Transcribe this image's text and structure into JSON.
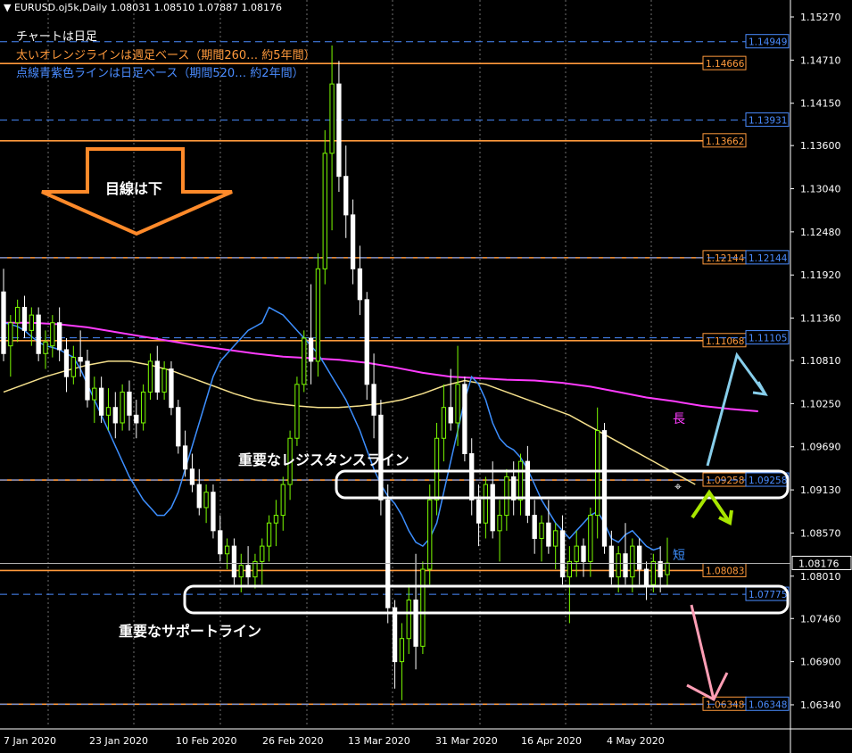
{
  "header": {
    "symbol": "EURUSD.oj5k,Daily",
    "ohlc": "1.08031 1.08510 1.07887 1.08176"
  },
  "notes": [
    {
      "text": "チャートは日足",
      "color": "#ffffff"
    },
    {
      "text": "太いオレンジラインは週足ベース（期間260… 約5年間）",
      "color": "#ff9a3c"
    },
    {
      "text": "点線青紫色ラインは日足ベース（期間520… 約2年間）",
      "color": "#4a8cff"
    }
  ],
  "annotations": {
    "arrow_text": "目線は下",
    "resistance": "重要なレジスタンスライン",
    "support": "重要なサポートライン",
    "long_ma": "長",
    "short_ma": "短"
  },
  "colors": {
    "background": "#000000",
    "grid": "#6f6f6f",
    "bull_candle": "#7CFC00",
    "bear_candle": "#ffffff",
    "orange_level": "#ff9a3c",
    "blue_level": "#4a8cff",
    "short_ma": "#3d8fff",
    "mid_ma": "#f5e08c",
    "long_ma": "#ff3cff",
    "current_price": "#b0b0b0"
  },
  "chart_data": {
    "type": "candlestick",
    "title": "EURUSD.oj5k,Daily",
    "timeframe": "Daily",
    "grid": true,
    "ylim": [
      1.0605,
      1.1549
    ],
    "y_ticks": [
      "1.15270",
      "1.14710",
      "1.14150",
      "1.13600",
      "1.13040",
      "1.12480",
      "1.11920",
      "1.11360",
      "1.10810",
      "1.10250",
      "1.09690",
      "1.09130",
      "1.08570",
      "1.08010",
      "1.07460",
      "1.06900",
      "1.06340"
    ],
    "x_ticks": [
      "7 Jan 2020",
      "23 Jan 2020",
      "10 Feb 2020",
      "26 Feb 2020",
      "13 Mar 2020",
      "31 Mar 2020",
      "16 Apr 2020",
      "4 May 2020"
    ],
    "current_price": "1.08176",
    "orange_levels": [
      "1.14666",
      "1.13662",
      "1.12144",
      "1.11068",
      "1.09258",
      "1.08083",
      "1.06348"
    ],
    "blue_levels": [
      "1.14949",
      "1.13931",
      "1.12144",
      "1.11105",
      "1.09258",
      "1.07775",
      "1.06348"
    ],
    "candles": [
      [
        1.117,
        1.12,
        1.108,
        1.109
      ],
      [
        1.11,
        1.114,
        1.106,
        1.113
      ],
      [
        1.113,
        1.116,
        1.1105,
        1.115
      ],
      [
        1.115,
        1.1165,
        1.111,
        1.112
      ],
      [
        1.112,
        1.115,
        1.11,
        1.114
      ],
      [
        1.114,
        1.115,
        1.108,
        1.109
      ],
      [
        1.109,
        1.112,
        1.107,
        1.1105
      ],
      [
        1.11,
        1.114,
        1.1085,
        1.113
      ],
      [
        1.113,
        1.115,
        1.108,
        1.1095
      ],
      [
        1.1095,
        1.111,
        1.104,
        1.106
      ],
      [
        1.106,
        1.11,
        1.105,
        1.1085
      ],
      [
        1.1085,
        1.112,
        1.106,
        1.108
      ],
      [
        1.108,
        1.1095,
        1.102,
        1.103
      ],
      [
        1.103,
        1.106,
        1.1,
        1.1045
      ],
      [
        1.1045,
        1.106,
        1.1,
        1.101
      ],
      [
        1.101,
        1.1045,
        1.099,
        1.102
      ],
      [
        1.102,
        1.104,
        1.098,
        1.1
      ],
      [
        1.1,
        1.105,
        1.099,
        1.104
      ],
      [
        1.104,
        1.1055,
        1.099,
        1.101
      ],
      [
        1.101,
        1.103,
        1.098,
        1.1
      ],
      [
        1.1,
        1.105,
        1.099,
        1.104
      ],
      [
        1.104,
        1.109,
        1.103,
        1.108
      ],
      [
        1.108,
        1.11,
        1.103,
        1.104
      ],
      [
        1.104,
        1.108,
        1.103,
        1.107
      ],
      [
        1.107,
        1.108,
        1.101,
        1.102
      ],
      [
        1.102,
        1.103,
        1.096,
        1.097
      ],
      [
        1.097,
        1.099,
        1.093,
        1.094
      ],
      [
        1.094,
        1.096,
        1.091,
        1.092
      ],
      [
        1.092,
        1.094,
        1.088,
        1.089
      ],
      [
        1.089,
        1.092,
        1.087,
        1.091
      ],
      [
        1.091,
        1.092,
        1.085,
        1.086
      ],
      [
        1.086,
        1.088,
        1.082,
        1.083
      ],
      [
        1.083,
        1.085,
        1.081,
        1.084
      ],
      [
        1.084,
        1.085,
        1.079,
        1.08
      ],
      [
        1.08,
        1.083,
        1.078,
        1.0815
      ],
      [
        1.0815,
        1.084,
        1.079,
        1.08
      ],
      [
        1.08,
        1.083,
        1.0785,
        1.082
      ],
      [
        1.082,
        1.085,
        1.079,
        1.084
      ],
      [
        1.084,
        1.088,
        1.082,
        1.087
      ],
      [
        1.087,
        1.09,
        1.084,
        1.088
      ],
      [
        1.088,
        1.093,
        1.086,
        1.092
      ],
      [
        1.092,
        1.099,
        1.09,
        1.098
      ],
      [
        1.098,
        1.106,
        1.097,
        1.105
      ],
      [
        1.105,
        1.112,
        1.104,
        1.111
      ],
      [
        1.111,
        1.118,
        1.105,
        1.108
      ],
      [
        1.108,
        1.122,
        1.106,
        1.12
      ],
      [
        1.12,
        1.138,
        1.118,
        1.135
      ],
      [
        1.135,
        1.149,
        1.125,
        1.144
      ],
      [
        1.144,
        1.147,
        1.13,
        1.132
      ],
      [
        1.132,
        1.136,
        1.124,
        1.127
      ],
      [
        1.127,
        1.129,
        1.118,
        1.12
      ],
      [
        1.12,
        1.123,
        1.114,
        1.116
      ],
      [
        1.116,
        1.117,
        1.103,
        1.105
      ],
      [
        1.105,
        1.109,
        1.098,
        1.101
      ],
      [
        1.101,
        1.103,
        1.088,
        1.09
      ],
      [
        1.09,
        1.092,
        1.074,
        1.076
      ],
      [
        1.076,
        1.077,
        1.0655,
        1.069
      ],
      [
        1.069,
        1.074,
        1.064,
        1.072
      ],
      [
        1.072,
        1.079,
        1.07,
        1.077
      ],
      [
        1.077,
        1.083,
        1.068,
        1.071
      ],
      [
        1.071,
        1.082,
        1.07,
        1.081
      ],
      [
        1.081,
        1.092,
        1.079,
        1.09
      ],
      [
        1.09,
        1.1,
        1.088,
        1.098
      ],
      [
        1.098,
        1.105,
        1.095,
        1.102
      ],
      [
        1.102,
        1.107,
        1.099,
        1.1
      ],
      [
        1.1,
        1.11,
        1.097,
        1.105
      ],
      [
        1.105,
        1.106,
        1.095,
        1.096
      ],
      [
        1.096,
        1.098,
        1.088,
        1.09
      ],
      [
        1.09,
        1.092,
        1.084,
        1.087
      ],
      [
        1.087,
        1.093,
        1.085,
        1.092
      ],
      [
        1.092,
        1.095,
        1.085,
        1.086
      ],
      [
        1.086,
        1.09,
        1.082,
        1.088
      ],
      [
        1.088,
        1.094,
        1.086,
        1.093
      ],
      [
        1.093,
        1.095,
        1.088,
        1.09
      ],
      [
        1.09,
        1.096,
        1.088,
        1.095
      ],
      [
        1.095,
        1.097,
        1.087,
        1.088
      ],
      [
        1.088,
        1.09,
        1.083,
        1.085
      ],
      [
        1.085,
        1.088,
        1.082,
        1.087
      ],
      [
        1.087,
        1.09,
        1.083,
        1.084
      ],
      [
        1.084,
        1.087,
        1.081,
        1.086
      ],
      [
        1.086,
        1.088,
        1.079,
        1.08
      ],
      [
        1.08,
        1.084,
        1.074,
        1.082
      ],
      [
        1.082,
        1.086,
        1.08,
        1.084
      ],
      [
        1.084,
        1.085,
        1.08,
        1.082
      ],
      [
        1.082,
        1.089,
        1.08,
        1.088
      ],
      [
        1.088,
        1.102,
        1.085,
        1.099
      ],
      [
        1.099,
        1.1,
        1.083,
        1.084
      ],
      [
        1.084,
        1.086,
        1.079,
        1.08
      ],
      [
        1.08,
        1.084,
        1.078,
        1.083
      ],
      [
        1.083,
        1.087,
        1.079,
        1.08
      ],
      [
        1.08,
        1.085,
        1.078,
        1.084
      ],
      [
        1.084,
        1.085,
        1.079,
        1.081
      ],
      [
        1.081,
        1.082,
        1.077,
        1.079
      ],
      [
        1.079,
        1.083,
        1.078,
        1.082
      ],
      [
        1.082,
        1.084,
        1.078,
        1.08
      ],
      [
        1.0803,
        1.0851,
        1.0789,
        1.0818
      ]
    ],
    "ma_short": [
      1.115,
      1.1145,
      1.114,
      1.113,
      1.112,
      1.111,
      1.11,
      1.109,
      1.1075,
      1.106,
      1.1045,
      1.103,
      1.101,
      1.099,
      1.0965,
      1.094,
      1.092,
      1.0905,
      1.0895,
      1.088,
      1.086,
      1.0845,
      1.084,
      1.085,
      1.087,
      1.091,
      1.095,
      1.099,
      1.103,
      1.106,
      1.105,
      1.103,
      1.1,
      1.098,
      1.097,
      1.0965,
      1.0955,
      1.094,
      1.092,
      1.09,
      1.0885,
      1.087,
      1.086,
      1.085,
      1.086,
      1.087,
      1.088,
      1.0885,
      1.087,
      1.085,
      1.0845,
      1.0855,
      1.086,
      1.085,
      1.084,
      1.0835,
      1.0838
    ],
    "ma_short_start": 38,
    "ma_mid": [
      1.104,
      1.105,
      1.106,
      1.1068,
      1.1075,
      1.108,
      1.108,
      1.1075,
      1.1068,
      1.1058,
      1.1048,
      1.1038,
      1.103,
      1.1025,
      1.1022,
      1.102,
      1.102,
      1.1022,
      1.1025,
      1.103,
      1.1038,
      1.1048,
      1.1055,
      1.105,
      1.104,
      1.103,
      1.102,
      1.101,
      1.0995,
      1.098,
      1.0965,
      1.095,
      1.0935,
      1.092
    ],
    "ma_mid_step": 3,
    "ma_long": [
      1.113,
      1.113,
      1.1128,
      1.1124,
      1.1118,
      1.1112,
      1.1106,
      1.11,
      1.1095,
      1.109,
      1.1086,
      1.1084,
      1.1082,
      1.1078,
      1.1072,
      1.1065,
      1.106,
      1.1058,
      1.1056,
      1.1055,
      1.1052,
      1.1047,
      1.104,
      1.1033,
      1.1028,
      1.1022,
      1.1018,
      1.1015
    ],
    "ma_long_step": 4
  }
}
